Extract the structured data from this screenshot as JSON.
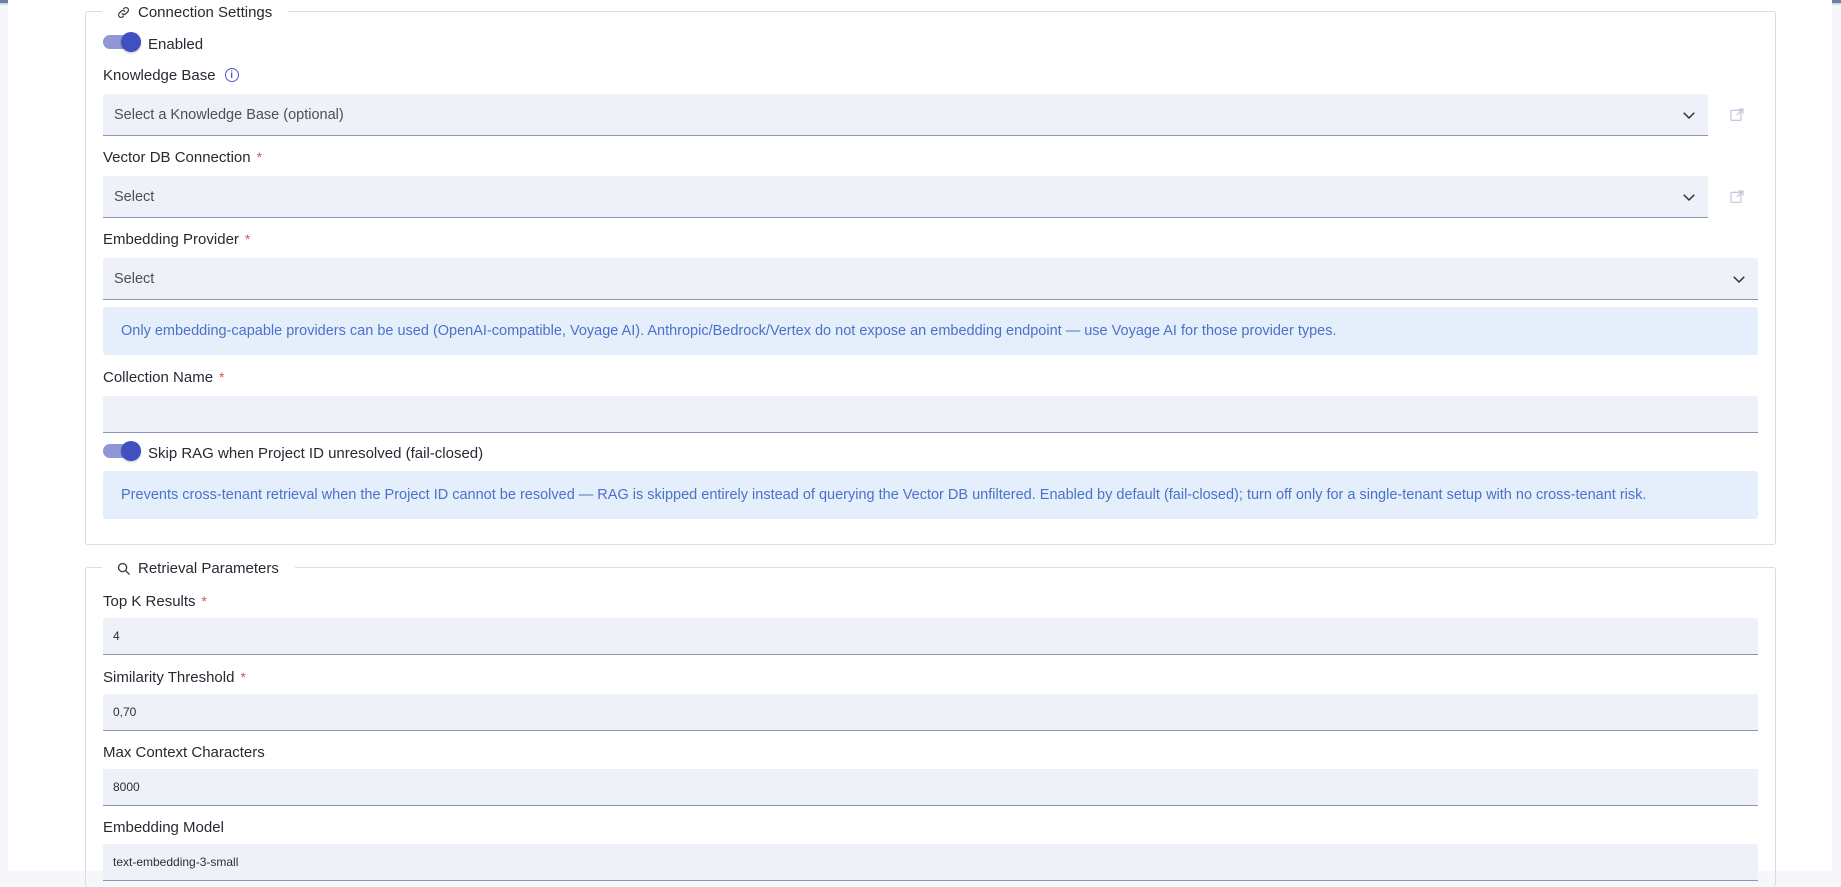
{
  "connection": {
    "legend": "Connection Settings",
    "enabled_label": "Enabled",
    "knowledge_base": {
      "label": "Knowledge Base",
      "placeholder": "Select a Knowledge Base (optional)"
    },
    "vector_db": {
      "label": "Vector DB Connection",
      "required": "*",
      "placeholder": "Select"
    },
    "embedding_provider": {
      "label": "Embedding Provider",
      "required": "*",
      "placeholder": "Select"
    },
    "provider_note": "Only embedding-capable providers can be used (OpenAI-compatible, Voyage AI). Anthropic/Bedrock/Vertex do not expose an embedding endpoint — use Voyage AI for those provider types.",
    "collection_name": {
      "label": "Collection Name",
      "required": "*",
      "value": ""
    },
    "skip_rag_label": "Skip RAG when Project ID unresolved (fail-closed)",
    "skip_rag_note": "Prevents cross-tenant retrieval when the Project ID cannot be resolved — RAG is skipped entirely instead of querying the Vector DB unfiltered. Enabled by default (fail-closed); turn off only for a single-tenant setup with no cross-tenant risk."
  },
  "retrieval": {
    "legend": "Retrieval Parameters",
    "top_k": {
      "label": "Top K Results",
      "required": "*",
      "value": "4"
    },
    "similarity": {
      "label": "Similarity Threshold",
      "required": "*",
      "value": "0,70"
    },
    "max_context": {
      "label": "Max Context Characters",
      "value": "8000"
    },
    "embedding_model": {
      "label": "Embedding Model",
      "value": "text-embedding-3-small"
    }
  },
  "colors": {
    "accent": "#4150c0",
    "note_bg": "#e5effc",
    "note_text": "#4a72c9",
    "required": "#e05555",
    "field_bg": "#eef2f8"
  }
}
